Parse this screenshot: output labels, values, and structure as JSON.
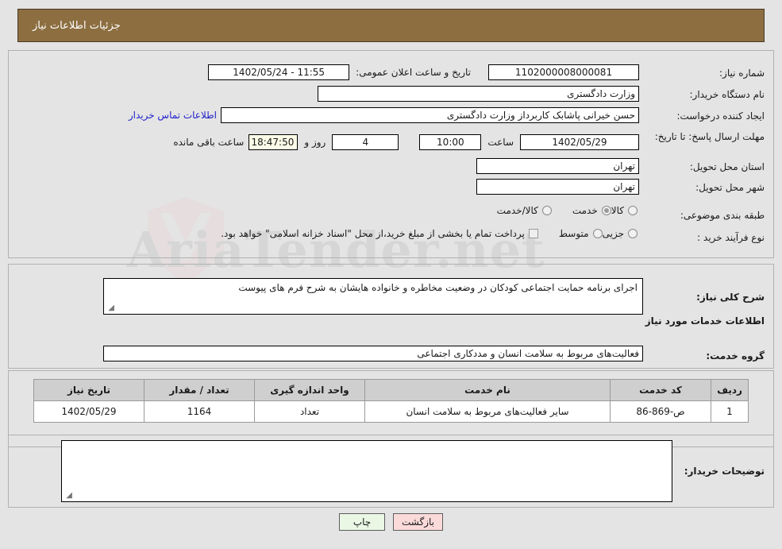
{
  "header": {
    "title": "جزئیات اطلاعات نیاز"
  },
  "colors": {
    "header_bar": "#8C6E41",
    "link": "#2222CC",
    "btn_print_bg": "#E9F7E4",
    "btn_back_bg": "#FBDADA",
    "table_header_bg": "#CFCFCF",
    "page_bg": "#E4E4E4",
    "highlight_field_bg": "#FBFBE8"
  },
  "watermark": {
    "text": "AriaTender.net"
  },
  "top_section": {
    "need_number": {
      "label": "شماره نیاز:",
      "value": "1102000008000081"
    },
    "public_announce": {
      "label": "تاریخ و ساعت اعلان عمومی:",
      "value": "11:55 - 1402/05/24"
    },
    "buyer_org": {
      "label": "نام دستگاه خریدار:",
      "value": "وزارت دادگستری"
    },
    "request_creator": {
      "label": "ایجاد کننده درخواست:",
      "value": "حسن خیرانی پاشابک کاربرداز وزارت دادگستری",
      "contact_link": "اطلاعات تماس خریدار"
    },
    "response_deadline": {
      "label": "مهلت ارسال پاسخ: تا تاریخ:",
      "date": "1402/05/29",
      "time_label": "ساعت",
      "time": "10:00",
      "days_value": "4",
      "days_label": "روز و",
      "hours_value": "18:47:50",
      "hours_label": "ساعت باقی مانده"
    },
    "delivery_province": {
      "label": "استان محل تحویل:",
      "value": "تهران"
    },
    "delivery_city": {
      "label": "شهر محل تحویل:",
      "value": "تهران"
    },
    "subject_classification": {
      "label": "طبقه بندی موضوعی:",
      "options": [
        {
          "label": "کالا",
          "selected": false
        },
        {
          "label": "خدمت",
          "selected": true
        },
        {
          "label": "کالا/خدمت",
          "selected": false
        }
      ]
    },
    "purchase_process_type": {
      "label": "نوع فرآیند خرید :",
      "options": [
        {
          "label": "جزیی",
          "selected": false
        },
        {
          "label": "متوسط",
          "selected": false
        }
      ],
      "checkbox_note": "پرداخت تمام یا بخشی از مبلغ خرید،از محل \"اسناد خزانه اسلامی\" خواهد بود.",
      "checkbox_checked": false
    }
  },
  "description_section": {
    "general_need": {
      "label": "شرح کلی نیاز:",
      "value": "اجرای برنامه حمایت اجتماعی کودکان در وضعیت مخاطره و خانواده هایشان به شرح فرم های پیوست"
    },
    "services_heading": "اطلاعات خدمات مورد نیاز",
    "service_group": {
      "label": "گروه خدمت:",
      "value": "فعالیت‌های مربوط به سلامت انسان و مددکاری اجتماعی"
    }
  },
  "table": {
    "columns": [
      "ردیف",
      "کد خدمت",
      "نام خدمت",
      "واحد اندازه گیری",
      "تعداد / مقدار",
      "تاریخ نیاز"
    ],
    "rows": [
      {
        "row_no": "1",
        "service_code": "ص-869-86",
        "service_name": "سایر فعالیت‌های مربوط به سلامت انسان",
        "unit": "تعداد",
        "quantity": "1164",
        "need_date": "1402/05/29"
      }
    ]
  },
  "notes_section": {
    "label": "توضیحات خریدار:",
    "value": ""
  },
  "footer": {
    "print_label": "چاپ",
    "back_label": "بازگشت"
  }
}
